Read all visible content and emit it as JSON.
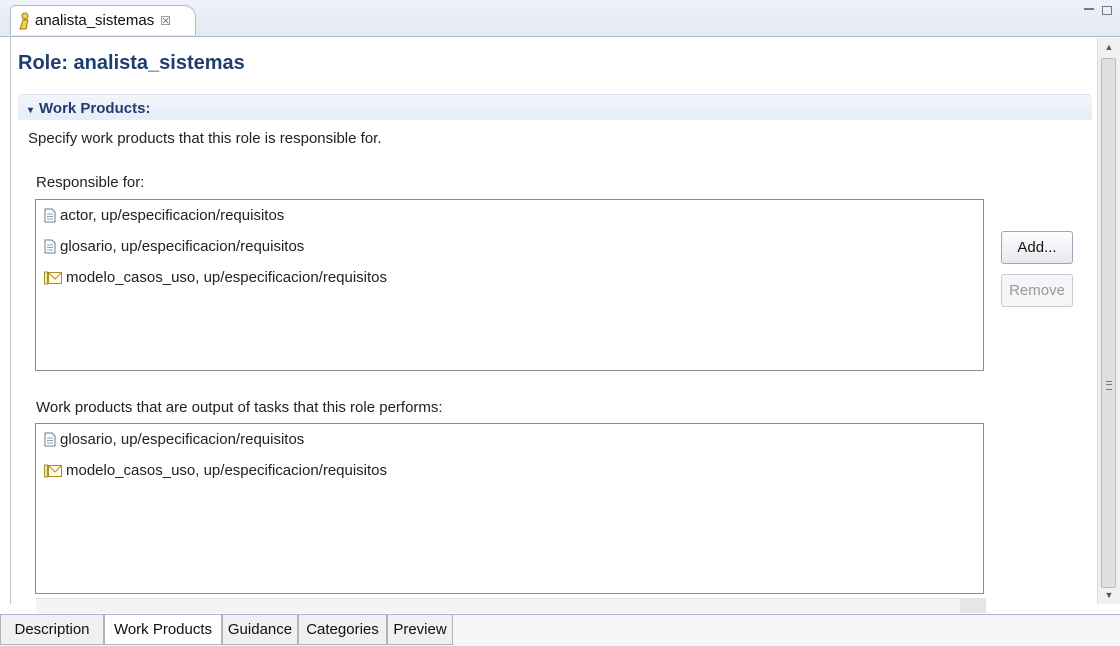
{
  "editor_tab": {
    "title": "analista_sistemas",
    "close_glyph": "☒",
    "icon": "role-icon"
  },
  "header": {
    "title": "Role: analista_sistemas"
  },
  "section": {
    "twisty": "▾",
    "title": "Work Products:",
    "description": "Specify work products that this role is responsible for."
  },
  "responsible": {
    "label": "Responsible for:",
    "items": [
      {
        "icon": "document-icon",
        "text": "actor, up/especificacion/requisitos"
      },
      {
        "icon": "document-icon",
        "text": "glosario, up/especificacion/requisitos"
      },
      {
        "icon": "model-icon",
        "text": "modelo_casos_uso, up/especificacion/requisitos"
      }
    ]
  },
  "buttons": {
    "add": "Add...",
    "remove": "Remove"
  },
  "outputs": {
    "label": "Work products that are output of tasks that this role performs:",
    "items": [
      {
        "icon": "document-icon",
        "text": "glosario, up/especificacion/requisitos"
      },
      {
        "icon": "model-icon",
        "text": "modelo_casos_uso, up/especificacion/requisitos"
      }
    ]
  },
  "page_tabs": [
    {
      "label": "Description",
      "active": false
    },
    {
      "label": "Work Products",
      "active": true
    },
    {
      "label": "Guidance",
      "active": false
    },
    {
      "label": "Categories",
      "active": false
    },
    {
      "label": "Preview",
      "active": false
    }
  ],
  "colors": {
    "title": "#1f3e70",
    "section_bg": "#e6edf7",
    "border": "#8c8c8c"
  }
}
